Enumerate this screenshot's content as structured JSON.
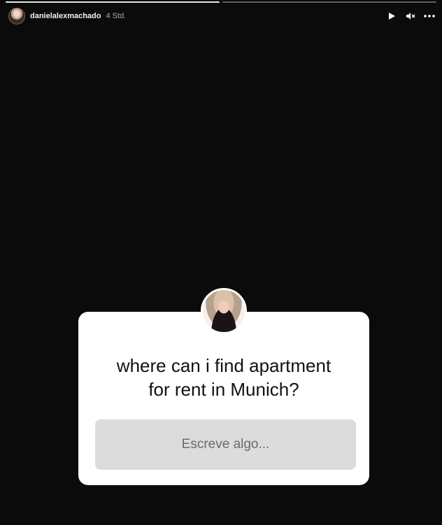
{
  "story": {
    "username": "danielalexmachado",
    "time_ago": "4 Std.",
    "progress_segments": 2,
    "active_segment": 1
  },
  "controls": {
    "play_icon": "play-icon",
    "mute_icon": "volume-muted-icon",
    "more_icon": "more-horizontal-icon"
  },
  "question_sticker": {
    "question": "where can i find apartment\nfor rent in Munich?",
    "reply_placeholder": "Escreve algo..."
  }
}
